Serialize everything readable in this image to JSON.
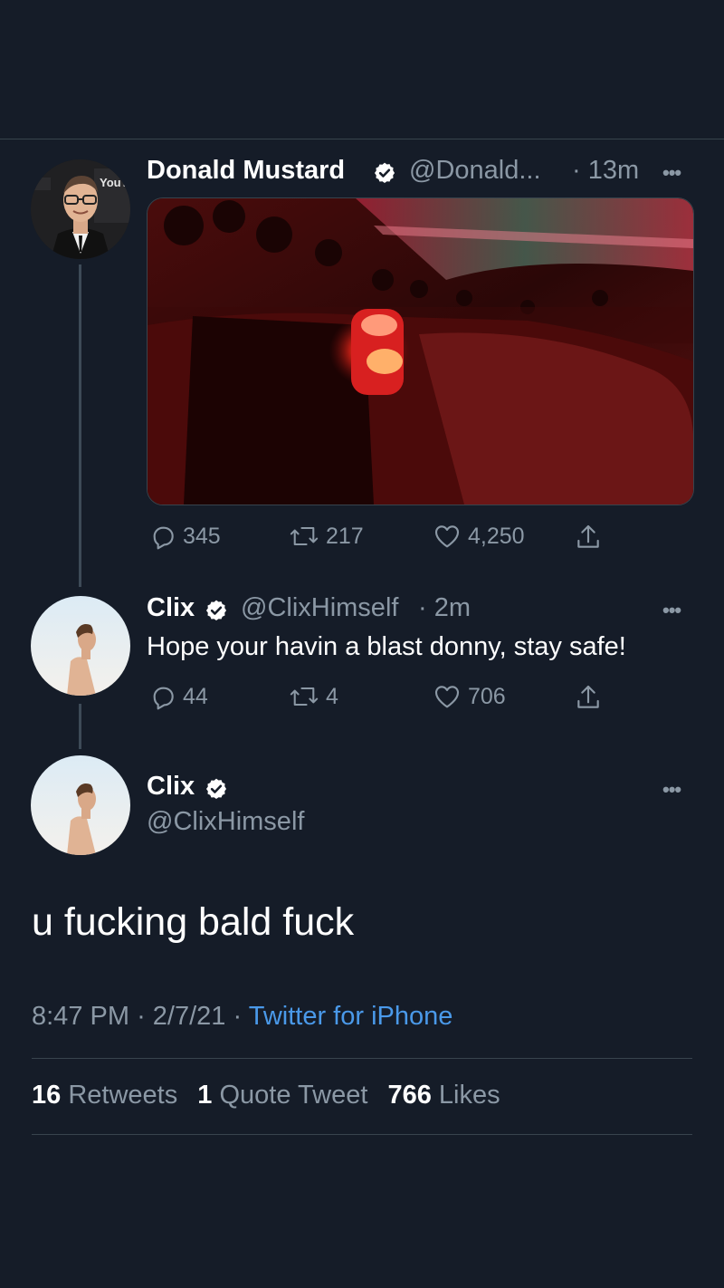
{
  "tweet1": {
    "author_name": "Donald Mustard",
    "author_handle": "@Donald...",
    "time": "· 13m",
    "replies": "345",
    "retweets": "217",
    "likes": "4,250",
    "avatar_text": "YouTu"
  },
  "tweet2": {
    "author_name": "Clix",
    "author_handle": "@ClixHimself",
    "time": "· 2m",
    "text": "Hope your havin a blast donny, stay safe!",
    "replies": "44",
    "retweets": "4",
    "likes": "706"
  },
  "tweet3": {
    "author_name": "Clix",
    "author_handle": "@ClixHimself",
    "text": "u fucking bald fuck",
    "time": "8:47 PM",
    "date": "2/7/21",
    "source": "Twitter for iPhone",
    "separator": "·"
  },
  "stats": {
    "retweets_count": "16",
    "retweets_label": "Retweets",
    "quotes_count": "1",
    "quotes_label": "Quote Tweet",
    "likes_count": "766",
    "likes_label": "Likes"
  },
  "more_label": "•••",
  "icons": {
    "verified": "verified-badge-icon",
    "reply": "reply-icon",
    "retweet": "retweet-icon",
    "like": "heart-icon",
    "share": "share-icon"
  },
  "colors": {
    "background": "#151c28",
    "secondary_text": "#8b98a5",
    "link": "#4a99e9",
    "divider": "#38444d"
  }
}
